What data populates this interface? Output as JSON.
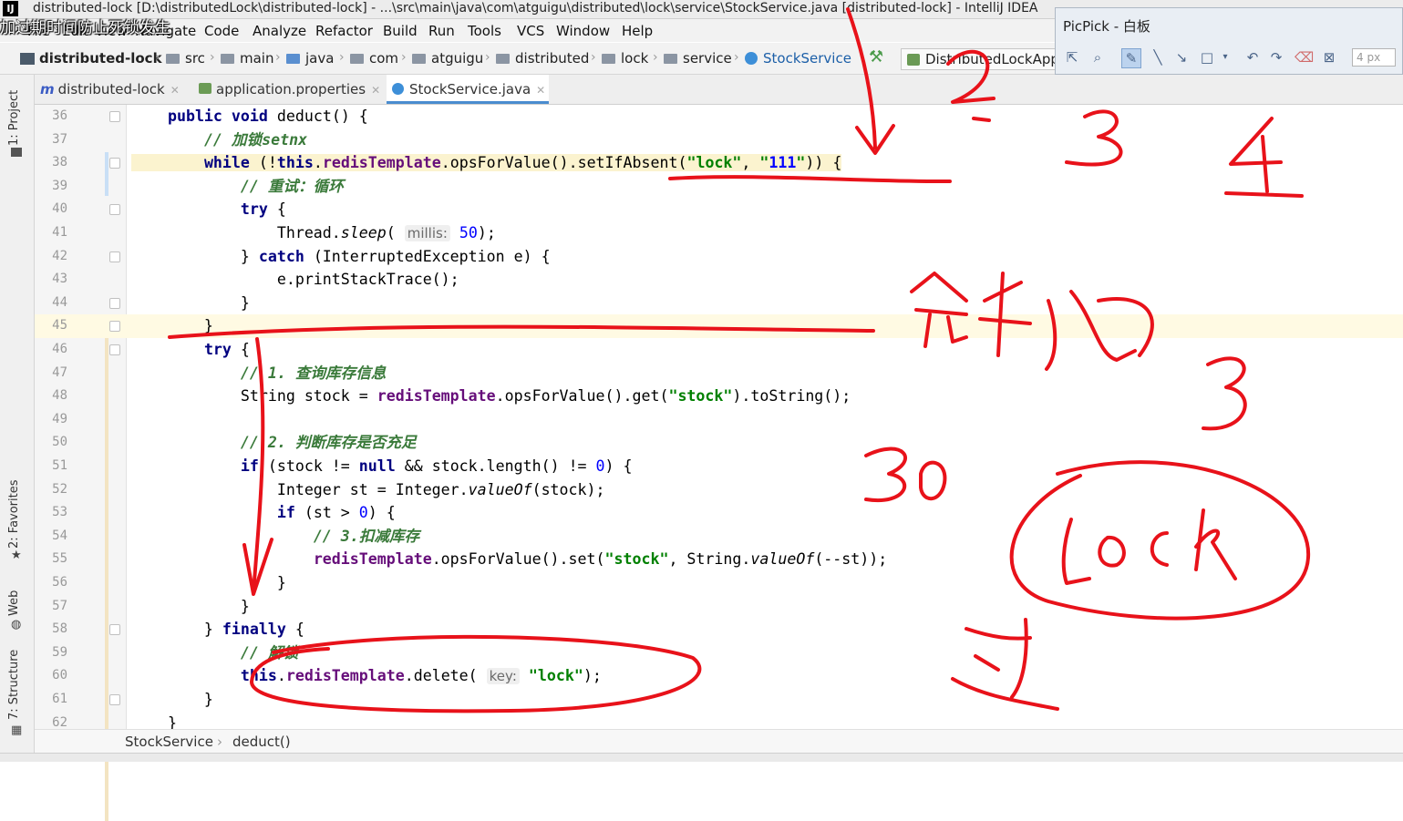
{
  "window": {
    "title": "distributed-lock [D:\\distributedLock\\distributed-lock] - ...\\src\\main\\java\\com\\atguigu\\distributed\\lock\\service\\StockService.java [distributed-lock] - IntelliJ IDEA",
    "overlay_caption": "加过期时间防止死锁发生"
  },
  "menu": [
    "File",
    "Edit",
    "View",
    "Navigate",
    "Code",
    "Analyze",
    "Refactor",
    "Build",
    "Run",
    "Tools",
    "VCS",
    "Window",
    "Help"
  ],
  "navbar": {
    "project": "distributed-lock",
    "crumbs": [
      "src",
      "main",
      "java",
      "com",
      "atguigu",
      "distributed",
      "lock",
      "service"
    ],
    "class": "StockService",
    "run_config": "DistributedLockApplication"
  },
  "picpick": {
    "title": "PicPick - 白板",
    "pen_size": "4 px",
    "tools": [
      "select-tool",
      "zoom-tool",
      "pen-tool",
      "line-tool",
      "arrow-tool",
      "rectangle-tool",
      "undo",
      "redo",
      "eraser-tool",
      "clear-tool"
    ]
  },
  "side_tabs": {
    "project": "1: Project",
    "favorites": "2: Favorites",
    "web": "Web",
    "structure": "7: Structure"
  },
  "editor_tabs": [
    {
      "label": "distributed-lock",
      "active": false
    },
    {
      "label": "application.properties",
      "active": false
    },
    {
      "label": "StockService.java",
      "active": true
    }
  ],
  "code": {
    "current_line": 45,
    "lines": [
      {
        "n": 36,
        "text": "    public void deduct() {"
      },
      {
        "n": 37,
        "text": "        // 加锁setnx"
      },
      {
        "n": 38,
        "text": "        while (!this.redisTemplate.opsForValue().setIfAbsent(\"lock\", \"111\")) {"
      },
      {
        "n": 39,
        "text": "            // 重试：循环"
      },
      {
        "n": 40,
        "text": "            try {"
      },
      {
        "n": 41,
        "text": "                Thread.sleep( millis: 50);"
      },
      {
        "n": 42,
        "text": "            } catch (InterruptedException e) {"
      },
      {
        "n": 43,
        "text": "                e.printStackTrace();"
      },
      {
        "n": 44,
        "text": "            }"
      },
      {
        "n": 45,
        "text": "        }"
      },
      {
        "n": 46,
        "text": "        try {"
      },
      {
        "n": 47,
        "text": "            // 1. 查询库存信息"
      },
      {
        "n": 48,
        "text": "            String stock = redisTemplate.opsForValue().get(\"stock\").toString();"
      },
      {
        "n": 49,
        "text": ""
      },
      {
        "n": 50,
        "text": "            // 2. 判断库存是否充足"
      },
      {
        "n": 51,
        "text": "            if (stock != null && stock.length() != 0) {"
      },
      {
        "n": 52,
        "text": "                Integer st = Integer.valueOf(stock);"
      },
      {
        "n": 53,
        "text": "                if (st > 0) {"
      },
      {
        "n": 54,
        "text": "                    // 3.扣减库存"
      },
      {
        "n": 55,
        "text": "                    redisTemplate.opsForValue().set(\"stock\", String.valueOf(--st));"
      },
      {
        "n": 56,
        "text": "                }"
      },
      {
        "n": 57,
        "text": "            }"
      },
      {
        "n": 58,
        "text": "        } finally {"
      },
      {
        "n": 59,
        "text": "            // 解锁"
      },
      {
        "n": 60,
        "text": "            this.redisTemplate.delete( key: \"lock\");"
      },
      {
        "n": 61,
        "text": "        }"
      },
      {
        "n": 62,
        "text": "    }"
      }
    ]
  },
  "code_breadcrumb": [
    "StockService",
    "deduct()"
  ],
  "annotations": {
    "ink_color": "#e8121a",
    "handwritten_numbers": [
      "2",
      "3",
      "4",
      "3",
      "30"
    ],
    "handwritten_words": [
      "宕机",
      "lock",
      "过"
    ]
  }
}
